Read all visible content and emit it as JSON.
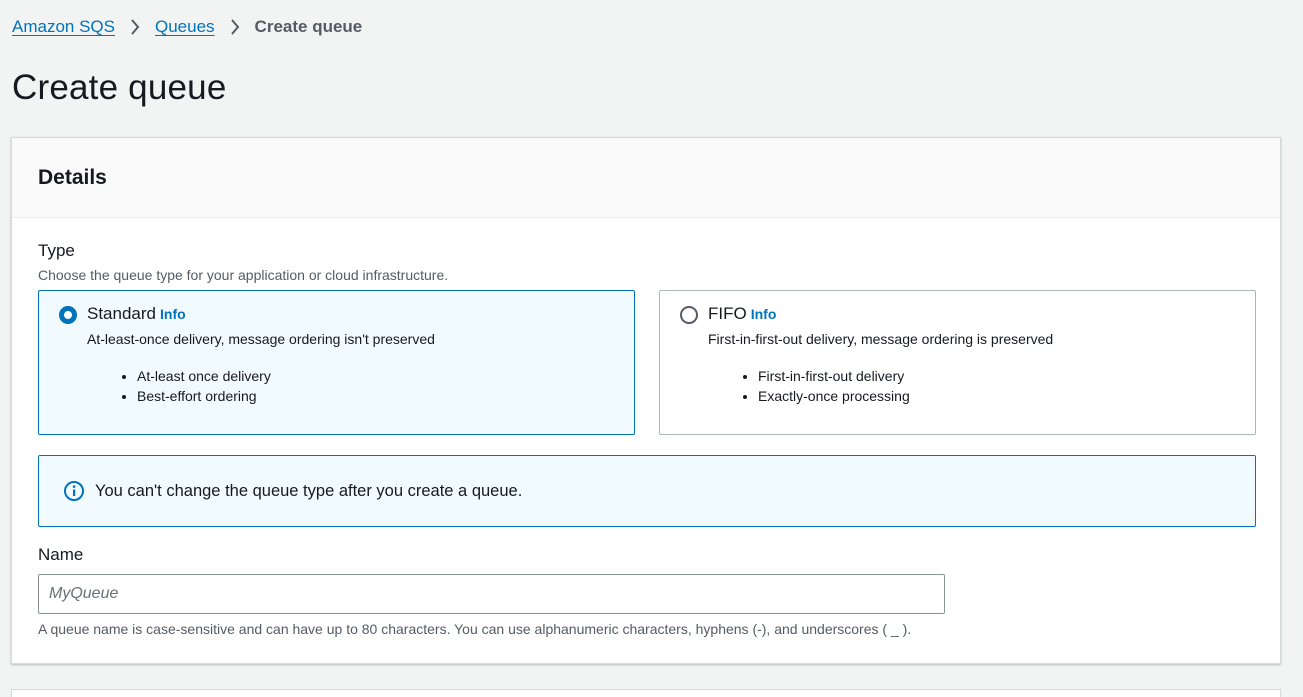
{
  "breadcrumb": {
    "items": [
      "Amazon SQS",
      "Queues"
    ],
    "current": "Create queue"
  },
  "page": {
    "title": "Create queue"
  },
  "details": {
    "heading": "Details",
    "type": {
      "label": "Type",
      "description": "Choose the queue type for your application or cloud infrastructure.",
      "options": [
        {
          "title": "Standard",
          "info": "Info",
          "description": "At-least-once delivery, message ordering isn't preserved",
          "bullets": [
            "At-least once delivery",
            "Best-effort ordering"
          ],
          "selected": true
        },
        {
          "title": "FIFO",
          "info": "Info",
          "description": "First-in-first-out delivery, message ordering is preserved",
          "bullets": [
            "First-in-first-out delivery",
            "Exactly-once processing"
          ],
          "selected": false
        }
      ]
    },
    "alert": {
      "icon": "info-icon",
      "text": "You can't change the queue type after you create a queue."
    },
    "name": {
      "label": "Name",
      "value": "",
      "placeholder": "MyQueue",
      "constraint": "A queue name is case-sensitive and can have up to 80 characters. You can use alphanumeric characters, hyphens (-), and underscores ( _ )."
    }
  },
  "colors": {
    "link": "#0073bb",
    "selected_bg": "#f1faff",
    "page_bg": "#f2f3f3"
  }
}
